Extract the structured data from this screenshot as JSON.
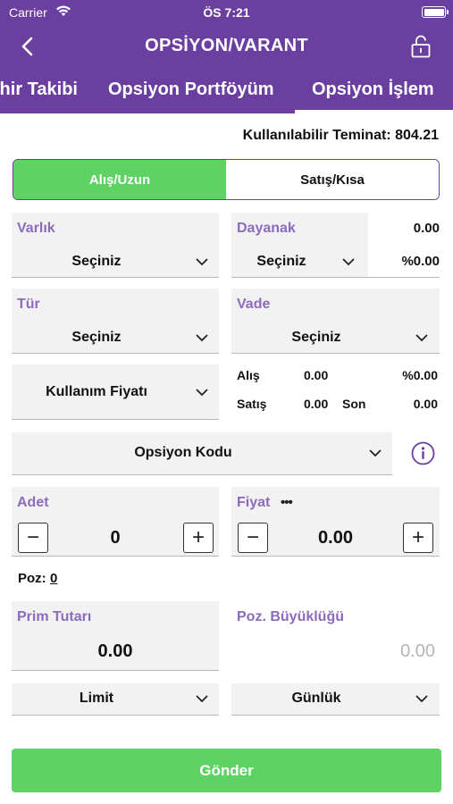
{
  "status": {
    "carrier": "Carrier",
    "time": "ÖS 7:21"
  },
  "header": {
    "title": "OPSİYON/VARANT"
  },
  "tabs": [
    {
      "label": "ıhir Takibi"
    },
    {
      "label": "Opsiyon Portföyüm"
    },
    {
      "label": "Opsiyon İşlem"
    }
  ],
  "teminat": "Kullanılabilir Teminat: 804.21",
  "side": {
    "buy": "Alış/Uzun",
    "sell": "Satış/Kısa"
  },
  "varlik": {
    "label": "Varlık",
    "value": "Seçiniz"
  },
  "dayanak": {
    "label": "Dayanak",
    "value": "Seçiniz",
    "price": "0.00",
    "change": "%0.00"
  },
  "tur": {
    "label": "Tür",
    "value": "Seçiniz"
  },
  "vade": {
    "label": "Vade",
    "value": "Seçiniz"
  },
  "kullanim": {
    "value": "Kullanım Fiyatı"
  },
  "quote": {
    "alis_label": "Alış",
    "alis": "0.00",
    "change": "%0.00",
    "satis_label": "Satış",
    "satis": "0.00",
    "son_label": "Son",
    "son": "0.00"
  },
  "kod": {
    "value": "Opsiyon Kodu"
  },
  "adet": {
    "label": "Adet",
    "value": "0",
    "minus": "−",
    "plus": "+"
  },
  "fiyat": {
    "label": "Fiyat",
    "dots": "•••",
    "value": "0.00",
    "minus": "−",
    "plus": "+"
  },
  "poz": {
    "label": "Poz:",
    "value": "0"
  },
  "prim": {
    "label": "Prim Tutarı",
    "value": "0.00"
  },
  "pozb": {
    "label": "Poz. Büyüklüğü",
    "value": "0.00"
  },
  "order_type": {
    "value": "Limit"
  },
  "validity": {
    "value": "Günlük"
  },
  "submit": {
    "label": "Gönder"
  },
  "colors": {
    "primary": "#6a3fa0",
    "accent": "#5ed364",
    "label": "#8c6bbd"
  }
}
